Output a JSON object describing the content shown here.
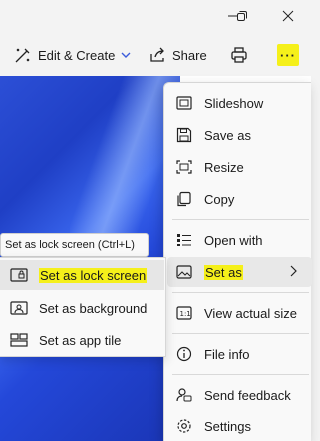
{
  "toolbar": {
    "edit_create_label": "Edit & Create",
    "share_label": "Share",
    "more_label": "···"
  },
  "tooltip": {
    "text": "Set as lock screen (Ctrl+L)"
  },
  "menu": {
    "items": [
      {
        "label": "Slideshow",
        "icon": "slideshow-icon"
      },
      {
        "label": "Save as",
        "icon": "save-icon"
      },
      {
        "label": "Resize",
        "icon": "resize-icon"
      },
      {
        "label": "Copy",
        "icon": "copy-icon"
      },
      {
        "label": "Open with",
        "icon": "open-with-icon"
      },
      {
        "label": "Set as",
        "icon": "image-icon"
      },
      {
        "label": "View actual size",
        "icon": "actual-size-icon"
      },
      {
        "label": "File info",
        "icon": "info-icon"
      },
      {
        "label": "Send feedback",
        "icon": "feedback-icon"
      },
      {
        "label": "Settings",
        "icon": "gear-icon"
      }
    ]
  },
  "submenu": {
    "items": [
      {
        "label": "Set as lock screen",
        "icon": "lock-screen-icon"
      },
      {
        "label": "Set as background",
        "icon": "background-icon"
      },
      {
        "label": "Set as app tile",
        "icon": "app-tile-icon"
      }
    ]
  },
  "colors": {
    "highlight": "#f5f01a",
    "accent": "#2448d9"
  }
}
